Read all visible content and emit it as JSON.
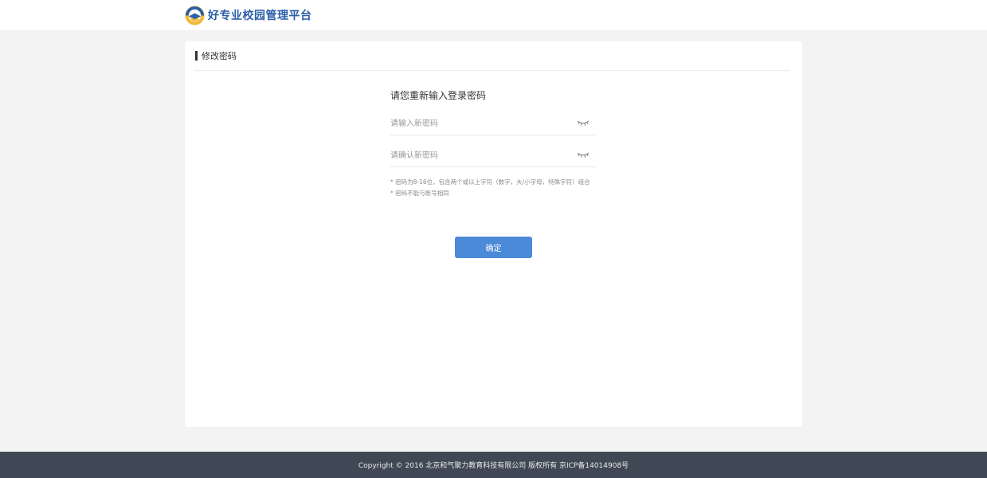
{
  "header": {
    "logo_text": "好专业校园管理平台"
  },
  "card": {
    "title": "修改密码"
  },
  "form": {
    "heading": "请您重新输入登录密码",
    "new_password": {
      "placeholder": "请输入新密码",
      "value": ""
    },
    "confirm_password": {
      "placeholder": "请确认新密码",
      "value": ""
    },
    "hints": [
      "* 密码为8-16位，包含两个或以上字符（数字，大/小字母，特殊字符）组合",
      "* 密码不能与账号相同"
    ],
    "submit_label": "确定"
  },
  "icons": {
    "logo": "school-logo-icon",
    "eye": "eye-closed-icon"
  },
  "colors": {
    "brand_text": "#2a5ea8",
    "button": "#4a8ad8",
    "footer_bg": "#3f4854",
    "page_bg": "#f3f3f3"
  },
  "footer": {
    "copyright": "Copyright © 2016 北京和气聚力教育科技有限公司 版权所有 京ICP备14014908号"
  }
}
